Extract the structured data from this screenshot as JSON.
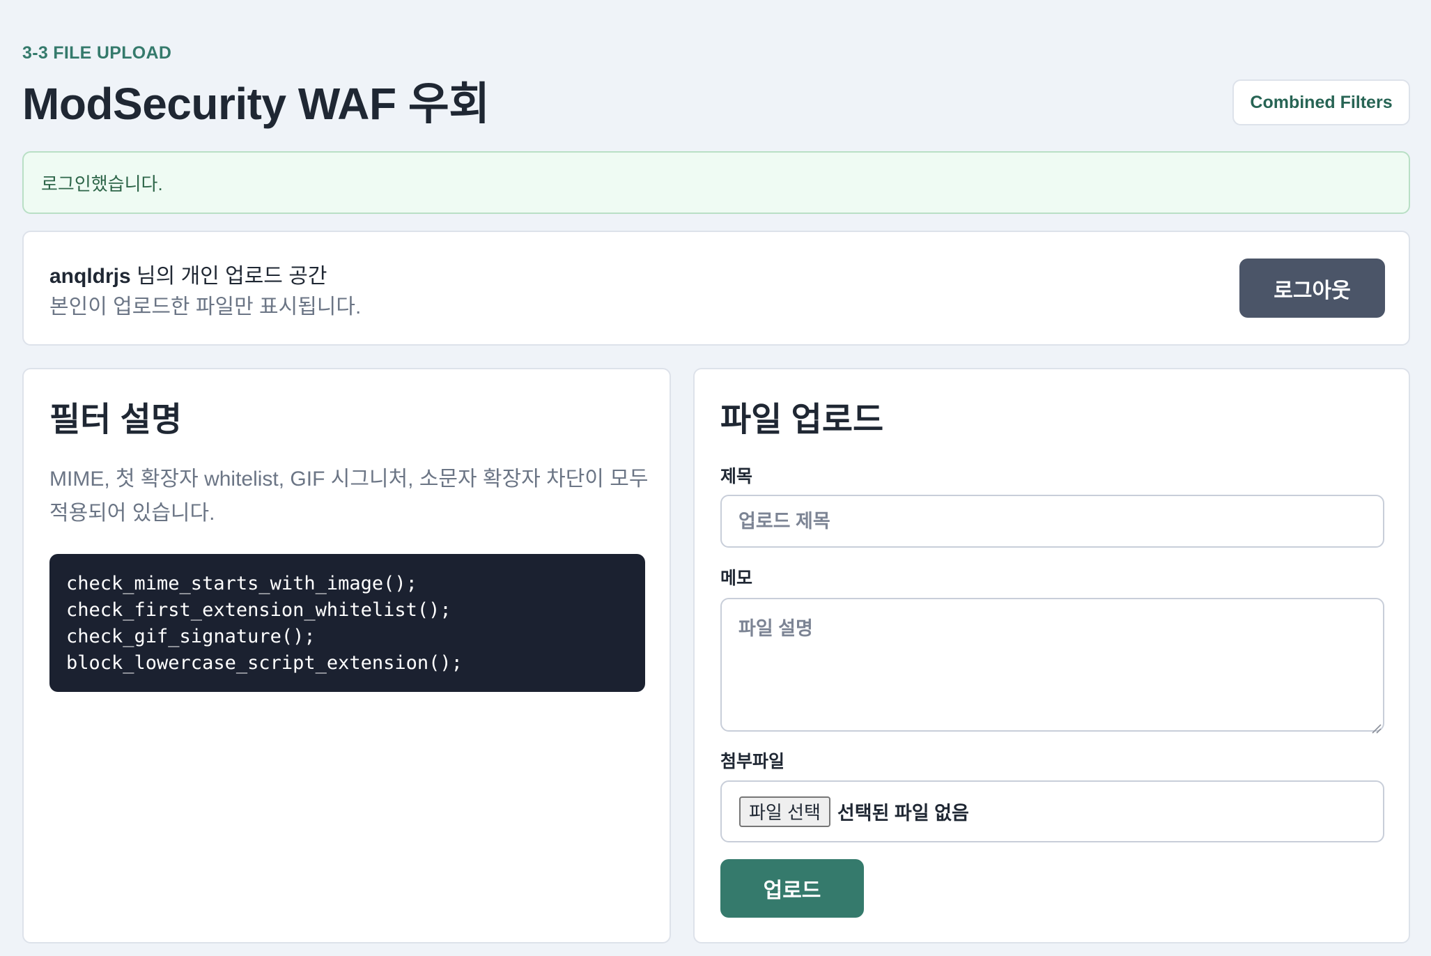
{
  "header": {
    "eyebrow": "3-3 FILE UPLOAD",
    "title": "ModSecurity WAF 우회",
    "nav_button": "Combined Filters"
  },
  "alert": {
    "message": "로그인했습니다."
  },
  "user_card": {
    "username": "anqldrjs",
    "space_suffix": " 님의 개인 업로드 공간",
    "subtitle": "본인이 업로드한 파일만 표시됩니다.",
    "logout_label": "로그아웃"
  },
  "filter_panel": {
    "heading": "필터 설명",
    "description": "MIME, 첫 확장자 whitelist, GIF 시그니처, 소문자 확장자 차단이 모두 적용되어 있습니다.",
    "code_lines": [
      "check_mime_starts_with_image();",
      "check_first_extension_whitelist();",
      "check_gif_signature();",
      "block_lowercase_script_extension();"
    ]
  },
  "upload_panel": {
    "heading": "파일 업로드",
    "title_label": "제목",
    "title_placeholder": "업로드 제목",
    "title_value": "",
    "memo_label": "메모",
    "memo_placeholder": "파일 설명",
    "memo_value": "",
    "file_label": "첨부파일",
    "file_choose_label": "파일 선택",
    "file_status": "선택된 파일 없음",
    "submit_label": "업로드"
  },
  "colors": {
    "accent": "#357a6c",
    "background": "#eff3f8",
    "alert_bg": "#effbf3",
    "logout_bg": "#4b5568",
    "code_bg": "#1b2130"
  }
}
